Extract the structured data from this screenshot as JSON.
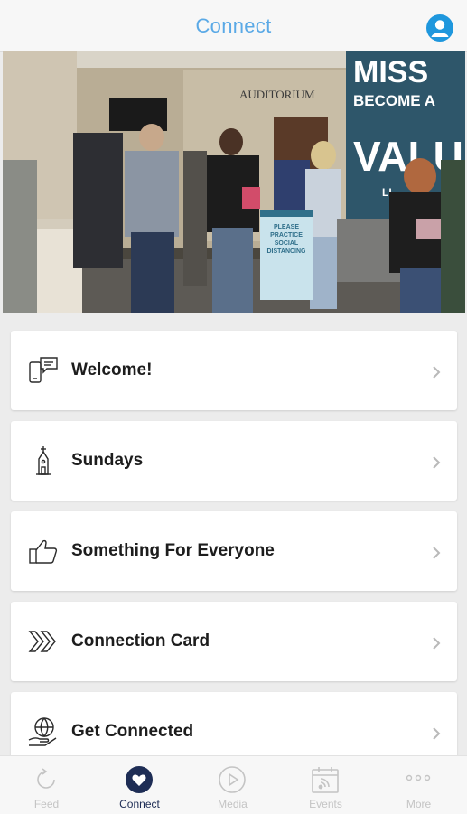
{
  "header": {
    "title": "Connect"
  },
  "hero": {
    "sign_auditorium": "AUDITORIUM",
    "wall_line1": "MISS",
    "wall_line2": "BECOME A",
    "wall_line3": "VALU",
    "wall_line4": "LI",
    "banner_text": "PLEASE PRACTICE SOCIAL DISTANCING"
  },
  "menu": {
    "items": [
      {
        "label": "Welcome!",
        "icon": "phone-chat-icon"
      },
      {
        "label": "Sundays",
        "icon": "church-icon"
      },
      {
        "label": "Something For Everyone",
        "icon": "thumbs-up-icon"
      },
      {
        "label": "Connection Card",
        "icon": "double-chevron-icon"
      },
      {
        "label": "Get Connected",
        "icon": "globe-hand-icon"
      }
    ]
  },
  "tabs": [
    {
      "label": "Feed",
      "icon": "refresh-icon",
      "active": false
    },
    {
      "label": "Connect",
      "icon": "heart-icon",
      "active": true
    },
    {
      "label": "Media",
      "icon": "play-icon",
      "active": false
    },
    {
      "label": "Events",
      "icon": "calendar-icon",
      "active": false
    },
    {
      "label": "More",
      "icon": "more-dots-icon",
      "active": false
    }
  ],
  "colors": {
    "header_title": "#5aa9e6",
    "profile": "#1f97dd",
    "active_tab": "#1e2d55",
    "inactive_tab": "#c4c4c4",
    "card_text": "#1d1d1d",
    "background": "#ececec"
  }
}
